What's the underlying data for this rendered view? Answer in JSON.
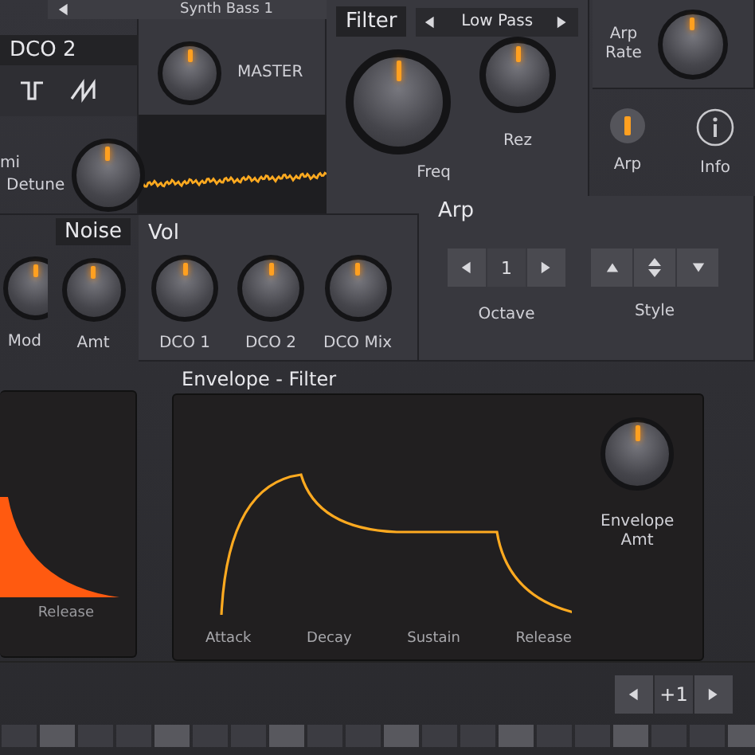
{
  "preset": {
    "name": "Synth Bass 1"
  },
  "dco2": {
    "title": "DCO 2",
    "waveforms": [
      {
        "kind": "square"
      },
      {
        "kind": "saw"
      }
    ],
    "labels": [
      "mi",
      "Detune"
    ],
    "knob": {
      "level": 0.5
    }
  },
  "master": {
    "label": "MASTER",
    "knob": {
      "level": 0.5
    }
  },
  "filter": {
    "title": "Filter",
    "type": "Low Pass",
    "knobs": [
      {
        "label": "Freq",
        "level": 0.5,
        "kind": "big"
      },
      {
        "label": "Rez",
        "level": 0.5,
        "kind": "small"
      }
    ]
  },
  "arp_rate": {
    "label": "Arp Rate",
    "knob": {
      "level": 0.5
    }
  },
  "toggles": [
    {
      "kind": "led",
      "label": "Arp",
      "on": true
    },
    {
      "kind": "info",
      "label": "Info"
    }
  ],
  "noise": {
    "title": "Noise",
    "knobs": [
      {
        "label": "Mod",
        "level": 0.5
      },
      {
        "label": "Amt",
        "level": 0.5
      }
    ]
  },
  "vol": {
    "title": "Vol",
    "knobs": [
      {
        "label": "DCO 1",
        "level": 0.5
      },
      {
        "label": "DCO 2",
        "level": 0.5
      },
      {
        "label": "DCO Mix",
        "level": 0.5
      }
    ]
  },
  "arp": {
    "title": "Arp",
    "octave": {
      "value": "1",
      "label": "Octave"
    },
    "style": {
      "label": "Style",
      "buttons": [
        {
          "kind": "up"
        },
        {
          "kind": "updown"
        },
        {
          "kind": "down"
        }
      ]
    }
  },
  "amp_envelope": {
    "labels": [
      "Release"
    ]
  },
  "filter_envelope": {
    "title": "Envelope - Filter",
    "stages": [
      "Attack",
      "Decay",
      "Sustain",
      "Release"
    ],
    "knob": {
      "label": "Envelope Amt",
      "level": 0.5
    }
  },
  "transpose": {
    "value": "+1"
  }
}
